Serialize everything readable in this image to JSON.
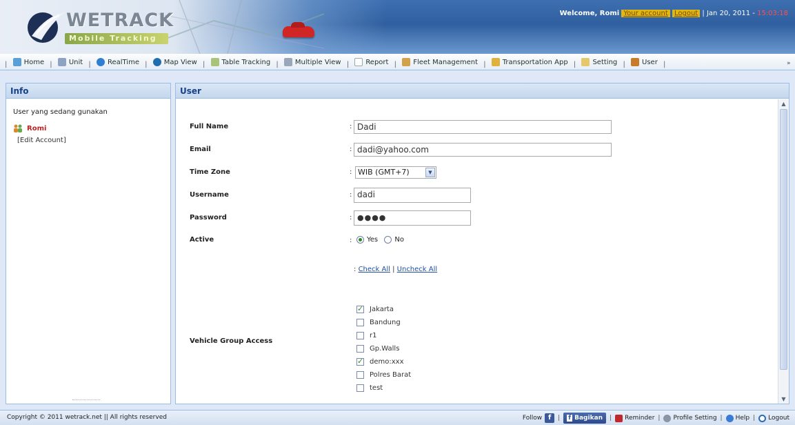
{
  "header": {
    "logo_title": "WETRACK",
    "logo_subtitle": "Mobile Tracking",
    "welcome_prefix": "Welcome, Romi",
    "your_account": "Your account",
    "logout": "Logout",
    "date": "Jan 20, 2011",
    "time": "15:03:18"
  },
  "menu": [
    {
      "label": "Home",
      "icon": "home-icon",
      "color": "#5aa0d6"
    },
    {
      "label": "Unit",
      "icon": "unit-icon",
      "color": "#8fa2c2"
    },
    {
      "label": "RealTime",
      "icon": "realtime-icon",
      "color": "#2f7fd0"
    },
    {
      "label": "Map View",
      "icon": "globe-icon",
      "color": "#1f6fb0"
    },
    {
      "label": "Table Tracking",
      "icon": "table-icon",
      "color": "#a9c47a"
    },
    {
      "label": "Multiple View",
      "icon": "multiple-view-icon",
      "color": "#9aa7b8"
    },
    {
      "label": "Report",
      "icon": "report-icon",
      "color": "#c8d2e0"
    },
    {
      "label": "Fleet Management",
      "icon": "fleet-icon",
      "color": "#d2a24a"
    },
    {
      "label": "Transportation App",
      "icon": "transport-icon",
      "color": "#e0b23c"
    },
    {
      "label": "Setting",
      "icon": "setting-icon",
      "color": "#e4c86a"
    },
    {
      "label": "User",
      "icon": "user-icon",
      "color": "#c87b2b"
    }
  ],
  "info_panel": {
    "title": "Info",
    "subtitle": "User yang sedang gunakan",
    "user_name": "Romi",
    "edit_account": "[Edit Account]"
  },
  "user_panel": {
    "title": "User",
    "full_name_label": "Full Name",
    "full_name_value": "Dadi",
    "email_label": "Email",
    "email_value": "dadi@yahoo.com",
    "timezone_label": "Time Zone",
    "timezone_value": "WIB (GMT+7)",
    "username_label": "Username",
    "username_value": "dadi",
    "password_label": "Password",
    "password_value": "●●●●",
    "active_label": "Active",
    "active_yes": "Yes",
    "active_no": "No",
    "active_selected": "Yes",
    "check_all": "Check All",
    "uncheck_all": "Uncheck All",
    "vehicle_group_label": "Vehicle Group Access",
    "vehicle_groups": [
      {
        "name": "Jakarta",
        "checked": true
      },
      {
        "name": "Bandung",
        "checked": false
      },
      {
        "name": "r1",
        "checked": false
      },
      {
        "name": "Gp.Walls",
        "checked": false
      },
      {
        "name": "demo:xxx",
        "checked": true
      },
      {
        "name": "Polres Barat",
        "checked": false
      },
      {
        "name": "test",
        "checked": false
      }
    ]
  },
  "footer": {
    "copyright": "Copyright © 2011 wetrack.net || All rights reserved",
    "follow": "Follow",
    "fb_button": "Bagikan",
    "reminder": "Reminder",
    "profile_setting": "Profile Setting",
    "help": "Help",
    "logout": "Logout"
  }
}
